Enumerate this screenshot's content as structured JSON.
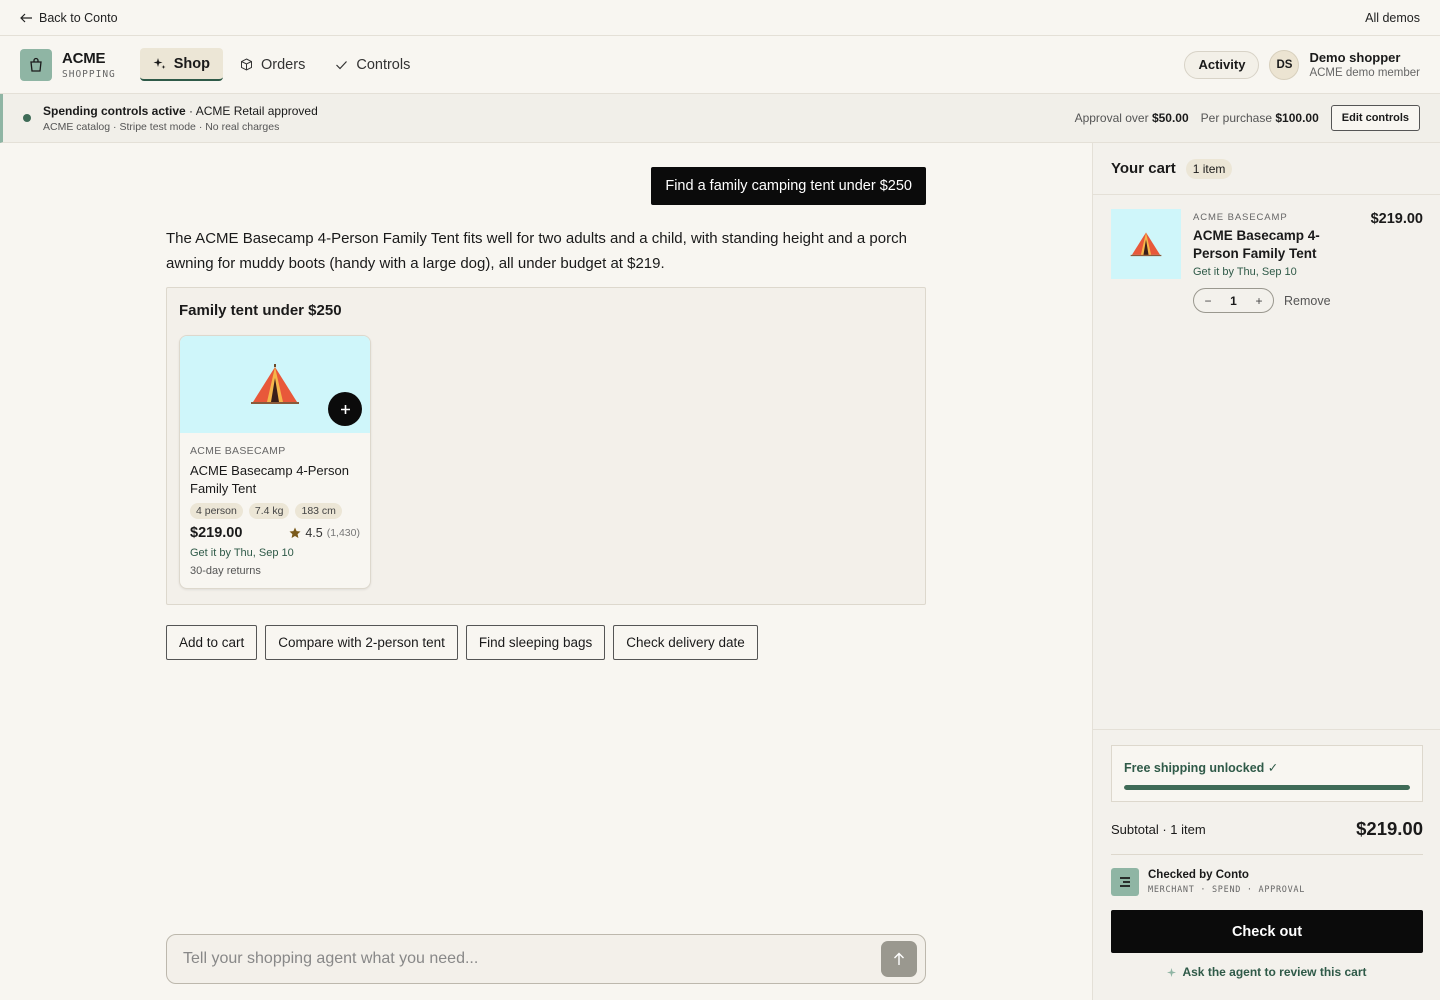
{
  "topbar": {
    "back_label": "Back to Conto",
    "all_demos_label": "All demos"
  },
  "brand": {
    "name": "ACME",
    "subtitle": "SHOPPING"
  },
  "nav": {
    "tabs": [
      {
        "label": "Shop",
        "icon": "sparkle-icon"
      },
      {
        "label": "Orders",
        "icon": "box-icon"
      },
      {
        "label": "Controls",
        "icon": "check-icon"
      }
    ],
    "activity_label": "Activity",
    "user": {
      "initials": "DS",
      "name": "Demo shopper",
      "role": "ACME demo member"
    }
  },
  "banner": {
    "status_text": "Spending controls active",
    "approval_text": " · ACME Retail approved",
    "subtext": "ACME catalog · Stripe test mode · No real charges",
    "approval_over_label": "Approval over",
    "approval_over_value": "$50.00",
    "per_purchase_label": "Per purchase",
    "per_purchase_value": "$100.00",
    "edit_label": "Edit controls"
  },
  "chat": {
    "user_message": "Find a family camping tent under $250",
    "agent_reply": "The ACME Basecamp 4-Person Family Tent fits well for two adults and a child, with standing height and a porch awning for muddy boots (handy with a large dog), all under budget at $219.",
    "results_title": "Family tent under $250",
    "product": {
      "brand": "ACME BASECAMP",
      "name": "ACME Basecamp 4-Person Family Tent",
      "chips": [
        "4 person",
        "7.4 kg",
        "183 cm"
      ],
      "price": "$219.00",
      "rating": "4.5",
      "rating_count": "(1,430)",
      "delivery": "Get it by Thu, Sep 10",
      "returns": "30-day returns"
    },
    "actions": [
      "Add to cart",
      "Compare with 2-person tent",
      "Find sleeping bags",
      "Check delivery date"
    ],
    "composer_placeholder": "Tell your shopping agent what you need..."
  },
  "cart": {
    "title": "Your cart",
    "count": "1 item",
    "item": {
      "brand": "ACME BASECAMP",
      "name": "ACME Basecamp 4-Person Family Tent",
      "delivery": "Get it by Thu, Sep 10",
      "price": "$219.00",
      "quantity": "1",
      "remove_label": "Remove"
    },
    "shipping_text": "Free shipping unlocked ✓",
    "shipping_progress": 1.0,
    "subtotal_label": "Subtotal · 1 item",
    "subtotal_value": "$219.00",
    "checked_by": "Checked by Conto",
    "checked_tags": "MERCHANT · SPEND · APPROVAL",
    "checkout_label": "Check out",
    "review_label": "Ask the agent to review this cart"
  },
  "colors": {
    "accent": "#3f6b57",
    "brand_tile": "#8fb5a4",
    "product_bg": "#cff6fa",
    "dark": "#0b0b0b"
  }
}
